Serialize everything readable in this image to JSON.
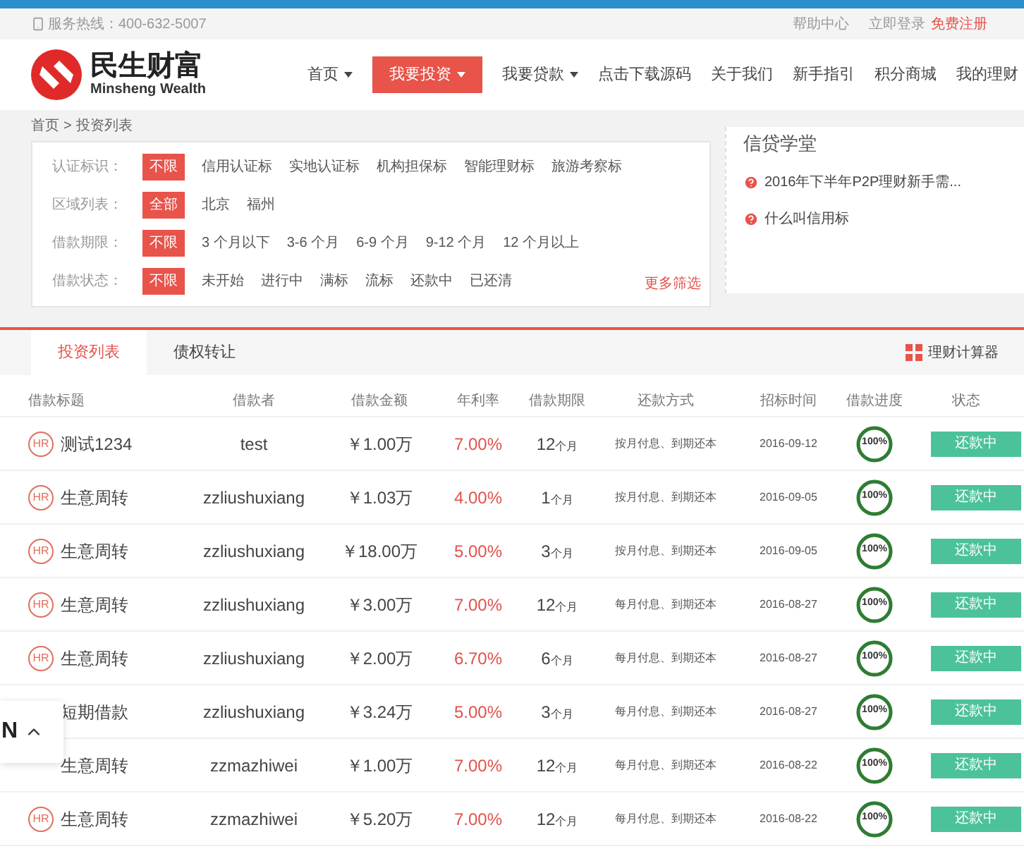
{
  "top_bar": {
    "hotline": "服务热线：400-632-5007",
    "links": [
      {
        "label": "帮助中心",
        "kind": "plain"
      },
      {
        "label": "立即登录",
        "kind": "plain"
      },
      {
        "label": "免费注册",
        "kind": "accent"
      }
    ]
  },
  "logo": {
    "name": "民生财富",
    "subtitle": "Minsheng Wealth"
  },
  "nav": [
    {
      "label": "首页",
      "dropdown": true,
      "selected": false
    },
    {
      "label": "我要投资",
      "dropdown": true,
      "selected": true
    },
    {
      "label": "我要贷款",
      "dropdown": true,
      "selected": false
    },
    {
      "label": "点击下载源码",
      "dropdown": false,
      "selected": false
    },
    {
      "label": "关于我们",
      "dropdown": false,
      "selected": false
    },
    {
      "label": "新手指引",
      "dropdown": false,
      "selected": false
    },
    {
      "label": "积分商城",
      "dropdown": false,
      "selected": false
    },
    {
      "label": "我的理财",
      "dropdown": false,
      "selected": false
    }
  ],
  "breadcrumb": {
    "home": "首页",
    "separator": ">",
    "current": "投资列表"
  },
  "filters": [
    {
      "label": "认证标识：",
      "options": [
        {
          "label": "不限",
          "selected": true
        },
        {
          "label": "信用认证标",
          "selected": false
        },
        {
          "label": "实地认证标",
          "selected": false
        },
        {
          "label": "机构担保标",
          "selected": false
        },
        {
          "label": "智能理财标",
          "selected": false
        },
        {
          "label": "旅游考察标",
          "selected": false
        }
      ]
    },
    {
      "label": "区域列表：",
      "options": [
        {
          "label": "全部",
          "selected": true
        },
        {
          "label": "北京",
          "selected": false
        },
        {
          "label": "福州",
          "selected": false
        }
      ]
    },
    {
      "label": "借款期限：",
      "options": [
        {
          "label": "不限",
          "selected": true
        },
        {
          "label": "3 个月以下",
          "selected": false
        },
        {
          "label": "3-6 个月",
          "selected": false
        },
        {
          "label": "6-9 个月",
          "selected": false
        },
        {
          "label": "9-12 个月",
          "selected": false
        },
        {
          "label": "12 个月以上",
          "selected": false
        }
      ]
    },
    {
      "label": "借款状态：",
      "options": [
        {
          "label": "不限",
          "selected": true
        },
        {
          "label": "未开始",
          "selected": false
        },
        {
          "label": "进行中",
          "selected": false
        },
        {
          "label": "满标",
          "selected": false
        },
        {
          "label": "流标",
          "selected": false
        },
        {
          "label": "还款中",
          "selected": false
        },
        {
          "label": "已还清",
          "selected": false
        }
      ]
    }
  ],
  "more_filters": "更多筛选",
  "school": {
    "title": "信贷学堂",
    "items": [
      "2016年下半年P2P理财新手需...",
      "什么叫信用标"
    ]
  },
  "tabs": [
    {
      "label": "投资列表",
      "selected": true
    },
    {
      "label": "债权转让",
      "selected": false
    }
  ],
  "calculator": "理财计算器",
  "table": {
    "columns": [
      "借款标题",
      "借款者",
      "借款金额",
      "年利率",
      "借款期限",
      "还款方式",
      "招标时间",
      "借款进度",
      "状态"
    ],
    "rows": [
      {
        "badge": "HR",
        "title": "测试1234",
        "borrower": "test",
        "amount": "￥1.00万",
        "rate": "7.00%",
        "period": "12",
        "period_unit": "个月",
        "method": "按月付息、到期还本",
        "date": "2016-09-12",
        "progress": "100%",
        "level": 1,
        "status": "还款中"
      },
      {
        "badge": "HR",
        "title": "生意周转",
        "borrower": "zzliushuxiang",
        "amount": "￥1.03万",
        "rate": "4.00%",
        "period": "1",
        "period_unit": "个月",
        "method": "按月付息、到期还本",
        "date": "2016-09-05",
        "progress": "100%",
        "level": 1,
        "status": "还款中"
      },
      {
        "badge": "HR",
        "title": "生意周转",
        "borrower": "zzliushuxiang",
        "amount": "￥18.00万",
        "rate": "5.00%",
        "period": "3",
        "period_unit": "个月",
        "method": "按月付息、到期还本",
        "date": "2016-09-05",
        "progress": "100%",
        "level": 1,
        "status": "还款中"
      },
      {
        "badge": "HR",
        "title": "生意周转",
        "borrower": "zzliushuxiang",
        "amount": "￥3.00万",
        "rate": "7.00%",
        "period": "12",
        "period_unit": "个月",
        "method": "每月付息、到期还本",
        "date": "2016-08-27",
        "progress": "100%",
        "level": 1,
        "status": "还款中"
      },
      {
        "badge": "HR",
        "title": "生意周转",
        "borrower": "zzliushuxiang",
        "amount": "￥2.00万",
        "rate": "6.70%",
        "period": "6",
        "period_unit": "个月",
        "method": "每月付息、到期还本",
        "date": "2016-08-27",
        "progress": "100%",
        "level": 1,
        "status": "还款中"
      },
      {
        "title": "短期借款",
        "borrower": "zzliushuxiang",
        "amount": "￥3.24万",
        "rate": "5.00%",
        "period": "3",
        "period_unit": "个月",
        "method": "每月付息、到期还本",
        "date": "2016-08-27",
        "progress": "100%",
        "level": 1,
        "status": "还款中"
      },
      {
        "title": "生意周转",
        "borrower": "zzmazhiwei",
        "amount": "￥1.00万",
        "rate": "7.00%",
        "period": "12",
        "period_unit": "个月",
        "method": "每月付息、到期还本",
        "date": "2016-08-22",
        "progress": "100%",
        "level": 1,
        "status": "还款中"
      },
      {
        "badge": "HR",
        "title": "生意周转",
        "borrower": "zzmazhiwei",
        "amount": "￥5.20万",
        "rate": "7.00%",
        "period": "12",
        "period_unit": "个月",
        "method": "每月付息、到期还本",
        "date": "2016-08-22",
        "progress": "100%",
        "level": 1,
        "status": "还款中"
      }
    ]
  },
  "floating_widget": {
    "label": "N"
  }
}
